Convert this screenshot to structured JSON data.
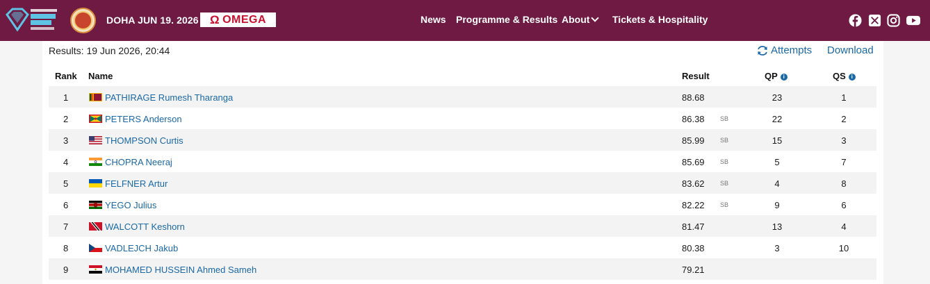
{
  "header": {
    "event_date": "DOHA JUN 19. 2026",
    "sponsor": "OMEGA",
    "nav": [
      {
        "label": "News"
      },
      {
        "label": "Programme & Results"
      },
      {
        "label": "About"
      },
      {
        "label": "Tickets & Hospitality"
      }
    ],
    "social_icons": [
      "facebook-icon",
      "x-icon",
      "instagram-icon",
      "youtube-icon"
    ],
    "bg_color": "#6e1a43"
  },
  "panel": {
    "results_title": "Results: 19 Jun 2026, 20:44",
    "attempts_label": "Attempts",
    "download_label": "Download",
    "link_color": "#1a68a6"
  },
  "table": {
    "columns": {
      "rank": "Rank",
      "name": "Name",
      "result": "Result",
      "qp": "QP",
      "qs": "QS"
    },
    "rows": [
      {
        "rank": "1",
        "flag": "Sri Lanka",
        "name": "PATHIRAGE Rumesh Tharanga",
        "result": "88.68",
        "sb": "",
        "qp": "23",
        "qs": "1"
      },
      {
        "rank": "2",
        "flag": "Grenada",
        "name": "PETERS Anderson",
        "result": "86.38",
        "sb": "SB",
        "qp": "22",
        "qs": "2"
      },
      {
        "rank": "3",
        "flag": "United States",
        "name": "THOMPSON Curtis",
        "result": "85.99",
        "sb": "SB",
        "qp": "15",
        "qs": "3"
      },
      {
        "rank": "4",
        "flag": "India",
        "name": "CHOPRA Neeraj",
        "result": "85.69",
        "sb": "SB",
        "qp": "5",
        "qs": "7"
      },
      {
        "rank": "5",
        "flag": "Ukraine",
        "name": "FELFNER Artur",
        "result": "83.62",
        "sb": "SB",
        "qp": "4",
        "qs": "8"
      },
      {
        "rank": "6",
        "flag": "Kenya",
        "name": "YEGO Julius",
        "result": "82.22",
        "sb": "SB",
        "qp": "9",
        "qs": "6"
      },
      {
        "rank": "7",
        "flag": "Trinidad and Tobago",
        "name": "WALCOTT Keshorn",
        "result": "81.47",
        "sb": "",
        "qp": "13",
        "qs": "4"
      },
      {
        "rank": "8",
        "flag": "Czech Republic",
        "name": "VADLEJCH Jakub",
        "result": "80.38",
        "sb": "",
        "qp": "3",
        "qs": "10"
      },
      {
        "rank": "9",
        "flag": "Egypt",
        "name": "MOHAMED HUSSEIN Ahmed Sameh",
        "result": "79.21",
        "sb": "",
        "qp": "",
        "qs": ""
      }
    ]
  }
}
